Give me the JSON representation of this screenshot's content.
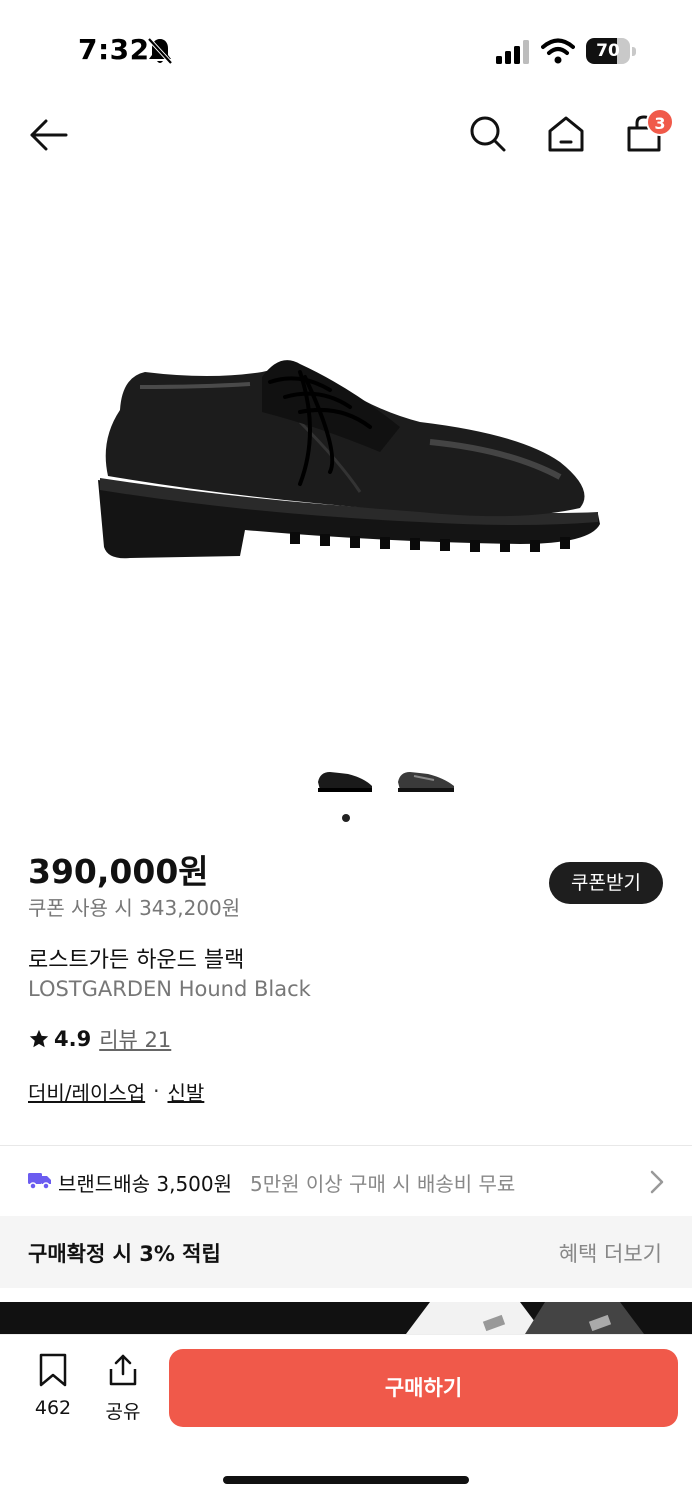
{
  "status_bar": {
    "time": "7:32",
    "battery": "70",
    "battery_level": 0.7
  },
  "nav": {
    "cart_count": "3"
  },
  "gallery": {
    "image_count": 2,
    "current_index": 1
  },
  "product": {
    "price": "390,000원",
    "coupon_price": "쿠폰 사용 시 343,200원",
    "coupon_button": "쿠폰받기",
    "name_ko": "로스트가든 하운드 블랙",
    "name_en": "LOSTGARDEN Hound Black",
    "rating": "4.9",
    "review_label": "리뷰 21",
    "category_1": "더비/레이스업",
    "category_sep": "·",
    "category_2": "신발"
  },
  "shipping": {
    "label": "브랜드배송 3,500원",
    "note": "5만원 이상 구매 시 배송비 무료"
  },
  "benefit": {
    "label": "구매확정 시 3% 적립",
    "more": "혜택 더보기"
  },
  "bottom_bar": {
    "bookmark_count": "462",
    "share_label": "공유",
    "buy_label": "구매하기"
  },
  "colors": {
    "accent": "#f0594a",
    "badge": "#f05a4a",
    "dark": "#1e1e1e",
    "truck": "#6b5cf0"
  }
}
